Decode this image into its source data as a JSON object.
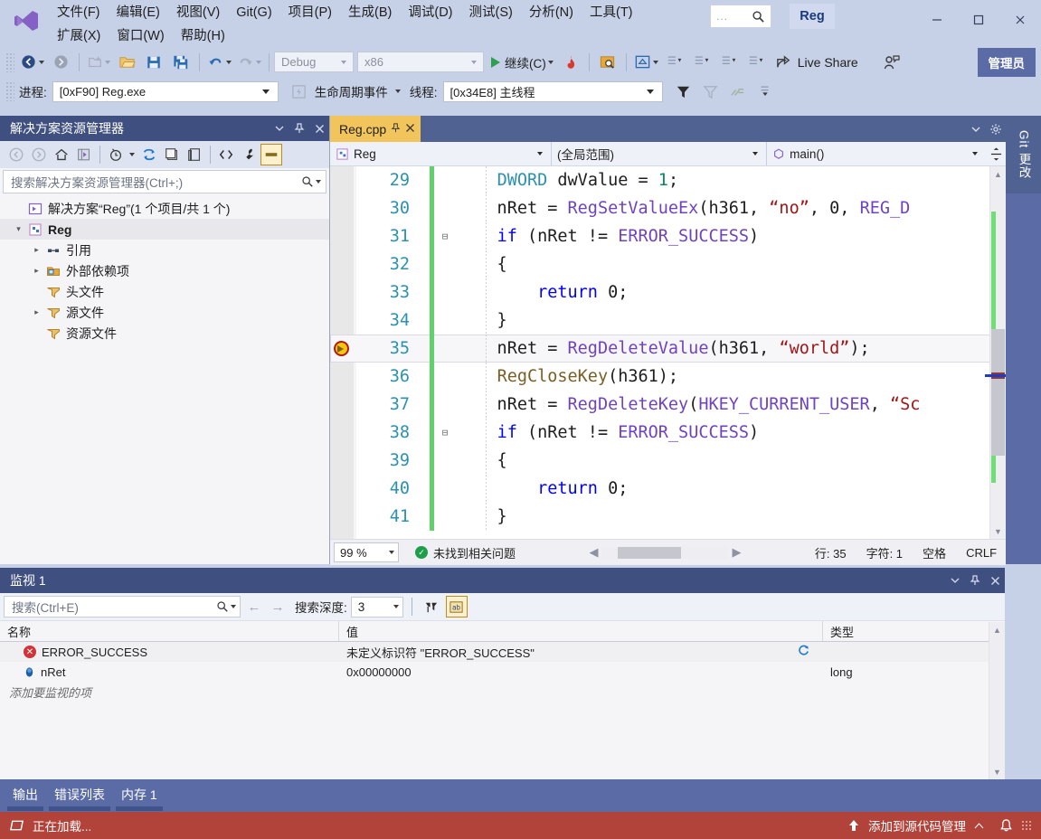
{
  "window": {
    "project_name": "Reg",
    "minimize": "—",
    "maximize": "☐",
    "close": "✕"
  },
  "menu": {
    "row1": [
      {
        "label": "文件(F)",
        "name": "menu-file"
      },
      {
        "label": "编辑(E)",
        "name": "menu-edit"
      },
      {
        "label": "视图(V)",
        "name": "menu-view"
      },
      {
        "label": "Git(G)",
        "name": "menu-git"
      },
      {
        "label": "项目(P)",
        "name": "menu-project"
      },
      {
        "label": "生成(B)",
        "name": "menu-build"
      },
      {
        "label": "调试(D)",
        "name": "menu-debug"
      },
      {
        "label": "测试(S)",
        "name": "menu-test"
      },
      {
        "label": "分析(N)",
        "name": "menu-analyze"
      },
      {
        "label": "工具(T)",
        "name": "menu-tools"
      }
    ],
    "row2": [
      {
        "label": "扩展(X)",
        "name": "menu-extensions"
      },
      {
        "label": "窗口(W)",
        "name": "menu-window"
      },
      {
        "label": "帮助(H)",
        "name": "menu-help"
      }
    ]
  },
  "quick_search": {
    "placeholder": "...",
    "icon": "search-icon"
  },
  "toolbar": {
    "configuration": "Debug",
    "platform": "x86",
    "run_label": "继续(C)",
    "live_share": "Live Share",
    "admin_badge": "管理员"
  },
  "debug_toolbar": {
    "process_label": "进程:",
    "process_value": "[0xF90] Reg.exe",
    "lifecycle_events": "生命周期事件",
    "thread_label": "线程:",
    "thread_value": "[0x34E8] 主线程"
  },
  "solution_explorer": {
    "title": "解决方案资源管理器",
    "search_placeholder": "搜索解决方案资源管理器(Ctrl+;)",
    "tree": [
      {
        "label": "解决方案“Reg”(1 个项目/共 1 个)",
        "indent": 0,
        "twisty": "",
        "icon": "solution-icon",
        "bold": false,
        "selected": false
      },
      {
        "label": "Reg",
        "indent": 1,
        "twisty": "▾",
        "icon": "project-icon",
        "bold": true,
        "selected": true
      },
      {
        "label": "引用",
        "indent": 2,
        "twisty": "▸",
        "icon": "references-icon",
        "bold": false,
        "selected": false
      },
      {
        "label": "外部依赖项",
        "indent": 2,
        "twisty": "▸",
        "icon": "external-deps-icon",
        "bold": false,
        "selected": false
      },
      {
        "label": "头文件",
        "indent": 2,
        "twisty": "",
        "icon": "filter-folder-icon",
        "bold": false,
        "selected": false
      },
      {
        "label": "源文件",
        "indent": 2,
        "twisty": "▸",
        "icon": "filter-folder-icon",
        "bold": false,
        "selected": false
      },
      {
        "label": "资源文件",
        "indent": 2,
        "twisty": "",
        "icon": "filter-folder-icon",
        "bold": false,
        "selected": false
      }
    ]
  },
  "editor": {
    "tab_name": "Reg.cpp",
    "nav_project": "Reg",
    "nav_scope": "(全局范围)",
    "nav_member": "main()",
    "lines": [
      {
        "num": "29",
        "fold": "",
        "current": false,
        "breakpoint": false,
        "tokens": [
          {
            "t": "    ",
            "c": "pl"
          },
          {
            "t": "DWORD",
            "c": "ty"
          },
          {
            "t": " dwValue ",
            "c": "pl"
          },
          {
            "t": "=",
            "c": "pl"
          },
          {
            "t": " ",
            "c": "pl"
          },
          {
            "t": "1",
            "c": "num"
          },
          {
            "t": ";",
            "c": "pl"
          }
        ]
      },
      {
        "num": "30",
        "fold": "",
        "current": false,
        "breakpoint": false,
        "tokens": [
          {
            "t": "    nRet = ",
            "c": "pl"
          },
          {
            "t": "RegSetValueEx",
            "c": "mac"
          },
          {
            "t": "(h361, ",
            "c": "pl"
          },
          {
            "t": "“no”",
            "c": "st"
          },
          {
            "t": ", ",
            "c": "pl"
          },
          {
            "t": "0",
            "c": "pl"
          },
          {
            "t": ", ",
            "c": "pl"
          },
          {
            "t": "REG_D",
            "c": "mac"
          }
        ]
      },
      {
        "num": "31",
        "fold": "⊟",
        "current": false,
        "breakpoint": false,
        "tokens": [
          {
            "t": "    ",
            "c": "pl"
          },
          {
            "t": "if",
            "c": "k"
          },
          {
            "t": " (nRet != ",
            "c": "pl"
          },
          {
            "t": "ERROR_SUCCESS",
            "c": "mac"
          },
          {
            "t": ")",
            "c": "pl"
          }
        ]
      },
      {
        "num": "32",
        "fold": "",
        "current": false,
        "breakpoint": false,
        "tokens": [
          {
            "t": "    {",
            "c": "pl"
          }
        ]
      },
      {
        "num": "33",
        "fold": "",
        "current": false,
        "breakpoint": false,
        "tokens": [
          {
            "t": "        ",
            "c": "pl"
          },
          {
            "t": "return",
            "c": "k"
          },
          {
            "t": " ",
            "c": "pl"
          },
          {
            "t": "0",
            "c": "pl"
          },
          {
            "t": ";",
            "c": "pl"
          }
        ]
      },
      {
        "num": "34",
        "fold": "",
        "current": false,
        "breakpoint": false,
        "tokens": [
          {
            "t": "    }",
            "c": "pl"
          }
        ]
      },
      {
        "num": "35",
        "fold": "",
        "current": true,
        "breakpoint": true,
        "tokens": [
          {
            "t": "    nRet = ",
            "c": "pl"
          },
          {
            "t": "RegDeleteValue",
            "c": "mac"
          },
          {
            "t": "(h361, ",
            "c": "pl"
          },
          {
            "t": "“world”",
            "c": "st"
          },
          {
            "t": ");",
            "c": "pl"
          }
        ]
      },
      {
        "num": "36",
        "fold": "",
        "current": false,
        "breakpoint": false,
        "tokens": [
          {
            "t": "    ",
            "c": "pl"
          },
          {
            "t": "RegCloseKey",
            "c": "fn"
          },
          {
            "t": "(h361);",
            "c": "pl"
          }
        ]
      },
      {
        "num": "37",
        "fold": "",
        "current": false,
        "breakpoint": false,
        "tokens": [
          {
            "t": "    nRet = ",
            "c": "pl"
          },
          {
            "t": "RegDeleteKey",
            "c": "mac"
          },
          {
            "t": "(",
            "c": "pl"
          },
          {
            "t": "HKEY_CURRENT_USER",
            "c": "mac"
          },
          {
            "t": ", ",
            "c": "pl"
          },
          {
            "t": "“Sc",
            "c": "st"
          }
        ]
      },
      {
        "num": "38",
        "fold": "⊟",
        "current": false,
        "breakpoint": false,
        "tokens": [
          {
            "t": "    ",
            "c": "pl"
          },
          {
            "t": "if",
            "c": "k"
          },
          {
            "t": " (nRet != ",
            "c": "pl"
          },
          {
            "t": "ERROR_SUCCESS",
            "c": "mac"
          },
          {
            "t": ")",
            "c": "pl"
          }
        ]
      },
      {
        "num": "39",
        "fold": "",
        "current": false,
        "breakpoint": false,
        "tokens": [
          {
            "t": "    {",
            "c": "pl"
          }
        ]
      },
      {
        "num": "40",
        "fold": "",
        "current": false,
        "breakpoint": false,
        "tokens": [
          {
            "t": "        ",
            "c": "pl"
          },
          {
            "t": "return",
            "c": "k"
          },
          {
            "t": " ",
            "c": "pl"
          },
          {
            "t": "0",
            "c": "pl"
          },
          {
            "t": ";",
            "c": "pl"
          }
        ]
      },
      {
        "num": "41",
        "fold": "",
        "current": false,
        "breakpoint": false,
        "tokens": [
          {
            "t": "    }",
            "c": "pl"
          }
        ]
      }
    ],
    "status": {
      "zoom": "99 %",
      "issues": "未找到相关问题",
      "line_label": "行: 35",
      "char_label": "字符: 1",
      "indent_label": "空格",
      "eol_label": "CRLF"
    }
  },
  "git_panel": {
    "title": "Git 更改"
  },
  "watch": {
    "title": "监视 1",
    "search_placeholder": "搜索(Ctrl+E)",
    "depth_label": "搜索深度:",
    "depth_value": "3",
    "columns": [
      "名称",
      "值",
      "类型"
    ],
    "rows": [
      {
        "name": "ERROR_SUCCESS",
        "value": "未定义标识符 \"ERROR_SUCCESS\"",
        "type": "",
        "icon": "error-icon",
        "refresh": true
      },
      {
        "name": "nRet",
        "value": "0x00000000",
        "type": "long",
        "icon": "variable-icon",
        "refresh": false
      }
    ],
    "add_row_placeholder": "添加要监视的项"
  },
  "bottom_tabs": [
    {
      "label": "输出",
      "name": "tab-output"
    },
    {
      "label": "错误列表",
      "name": "tab-error-list"
    },
    {
      "label": "内存 1",
      "name": "tab-memory-1"
    }
  ],
  "statusbar": {
    "left_text": "正在加载...",
    "right_text": "添加到源代码管理",
    "bell": "🔔"
  },
  "colors": {
    "chrome": "#c6d0e6",
    "panel_title": "#3f5080",
    "accent_tab": "#f2c55c",
    "status_bar": "#b1433a",
    "bottom_tabs": "#5a6ba5"
  }
}
